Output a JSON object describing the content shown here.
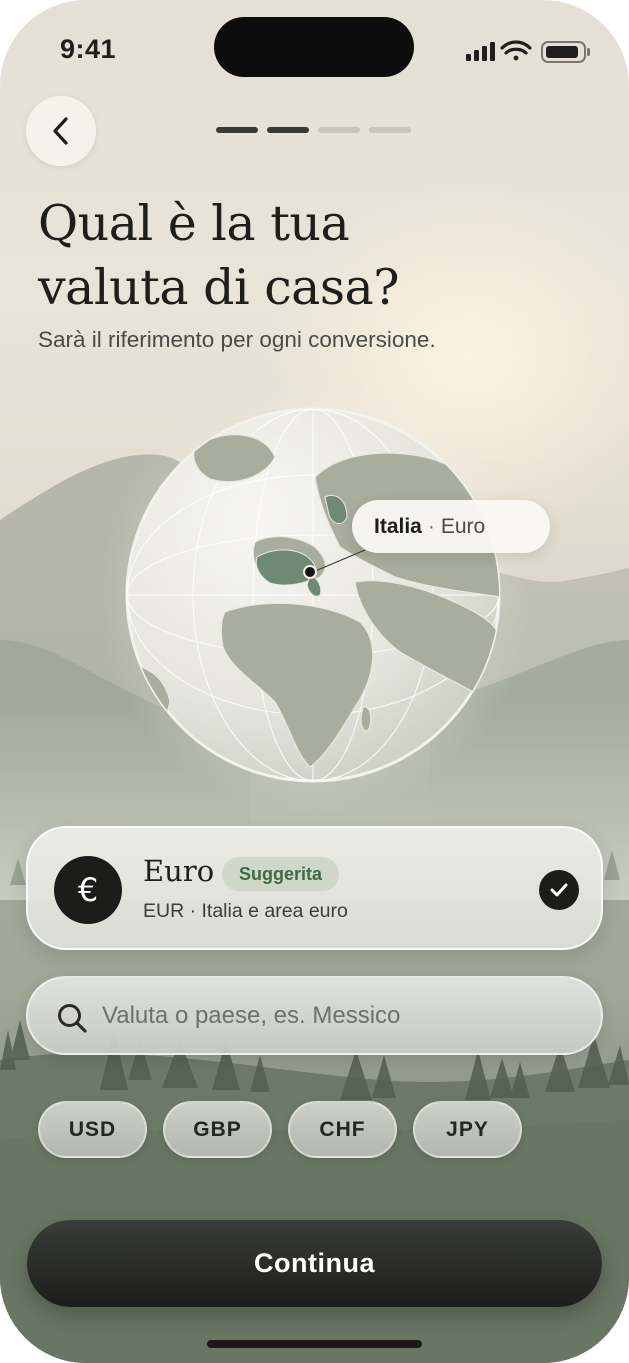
{
  "status_bar": {
    "time": "9:41",
    "icons": [
      "signal-icon",
      "wifi-icon",
      "battery-icon"
    ]
  },
  "nav": {
    "back_icon": "chevron-left-icon",
    "progress": {
      "total_steps": 4,
      "completed_steps": 2
    }
  },
  "header": {
    "title_line1": "Qual è la tua",
    "title_line2": "valuta di casa?",
    "subtitle": "Sarà il riferimento per ogni conversione."
  },
  "globe": {
    "tooltip_country": "Italia",
    "tooltip_separator": "·",
    "tooltip_currency": "Euro"
  },
  "selected_currency": {
    "symbol": "€",
    "name": "Euro",
    "badge": "Suggerita",
    "detail": "EUR · Italia e area euro",
    "selected": true
  },
  "search": {
    "placeholder": "Valuta o paese, es. Messico",
    "value": ""
  },
  "quick_chips": [
    "USD",
    "GBP",
    "CHF",
    "JPY"
  ],
  "cta": {
    "label": "Continua"
  },
  "colors": {
    "primary_dark": "#1c1c1a",
    "badge_bg": "#cfd8c8",
    "badge_text": "#3e6a45",
    "highlight_land": "#6f8a72"
  }
}
